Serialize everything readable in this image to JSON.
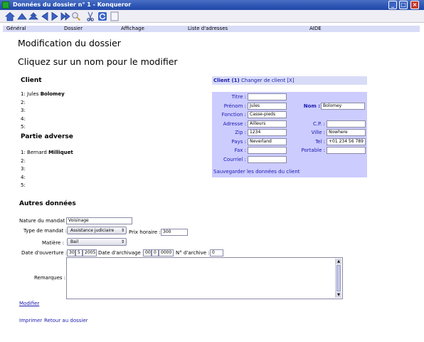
{
  "window": {
    "title": "Données du dossier n° 1 - Konqueror",
    "controls": {
      "minimize": "_",
      "maximize": "□",
      "close": "×"
    }
  },
  "toolbar": {
    "icons": [
      "home-icon",
      "up-icon",
      "back-icon",
      "forward-icon",
      "fast-forward-icon",
      "find-icon",
      "cut-icon",
      "reload-icon",
      "stop-icon"
    ]
  },
  "menu": {
    "items": [
      "Général",
      "Dossier",
      "Affichage",
      "Liste d'adresses",
      "AIDE"
    ]
  },
  "page": {
    "heading": "Modification du dossier",
    "subheading": "Cliquez sur un nom pour le modifier"
  },
  "client_section": {
    "title": "Client",
    "entries": [
      {
        "num": "1:",
        "first": "Jules",
        "last": "Bolomey"
      },
      {
        "num": "2:",
        "first": "",
        "last": ""
      },
      {
        "num": "3:",
        "first": "",
        "last": ""
      },
      {
        "num": "4:",
        "first": "",
        "last": ""
      },
      {
        "num": "5:",
        "first": "",
        "last": ""
      }
    ]
  },
  "adverse_section": {
    "title": "Partie adverse",
    "entries": [
      {
        "num": "1:",
        "first": "Bernard",
        "last": "Milliquet"
      },
      {
        "num": "2:",
        "first": "",
        "last": ""
      },
      {
        "num": "3:",
        "first": "",
        "last": ""
      },
      {
        "num": "4:",
        "first": "",
        "last": ""
      },
      {
        "num": "5:",
        "first": "",
        "last": ""
      }
    ]
  },
  "client_panel": {
    "tab_active": "Client (1)",
    "tab_change": "Changer de client",
    "tab_close": "[X]",
    "fields": {
      "titre": {
        "label": "Titre :",
        "value": ""
      },
      "prenom": {
        "label": "Prénom :",
        "value": "Jules"
      },
      "nom": {
        "label": "Nom :",
        "value": "Bolomey"
      },
      "fonction": {
        "label": "Fonction :",
        "value": "Casse-pieds"
      },
      "adresse": {
        "label": "Adresse :",
        "value": "Ailleurs"
      },
      "cp": {
        "label": "C.P. :",
        "value": ""
      },
      "zip": {
        "label": "Zip :",
        "value": "1234"
      },
      "ville": {
        "label": "Ville :",
        "value": "Nowhere"
      },
      "pays": {
        "label": "Pays :",
        "value": "Neverland"
      },
      "tel": {
        "label": "Tel :",
        "value": "+01 234 56 789"
      },
      "fax": {
        "label": "Fax :",
        "value": ""
      },
      "portable": {
        "label": "Portable :",
        "value": ""
      },
      "courriel": {
        "label": "Courriel :",
        "value": ""
      }
    },
    "save_label": "Sauvegarder les données du client"
  },
  "other_data": {
    "title": "Autres données",
    "nature_label": "Nature du mandat :",
    "nature_value": "Voisinage",
    "type_label": "Type de mandat :",
    "type_value": "Assistance judiciaire",
    "prix_label": "Prix horaire :",
    "prix_value": "300",
    "matiere_label": "Matière :",
    "matiere_value": "Bail",
    "ouverture_label": "Date d'ouverture :",
    "ouverture_day": "30",
    "ouverture_month": "5",
    "ouverture_year": "2005",
    "archivage_label": "Date d'archivage :",
    "archivage_day": "00",
    "archivage_month": "0",
    "archivage_year": "0000",
    "archive_num_label": "N° d'archive :",
    "archive_num_value": "0",
    "remarques_label": "Remarques :",
    "remarques_value": ""
  },
  "links": {
    "modifier": "Modifier",
    "imprimer": "Imprimer",
    "retour": "Retour au dossier"
  }
}
